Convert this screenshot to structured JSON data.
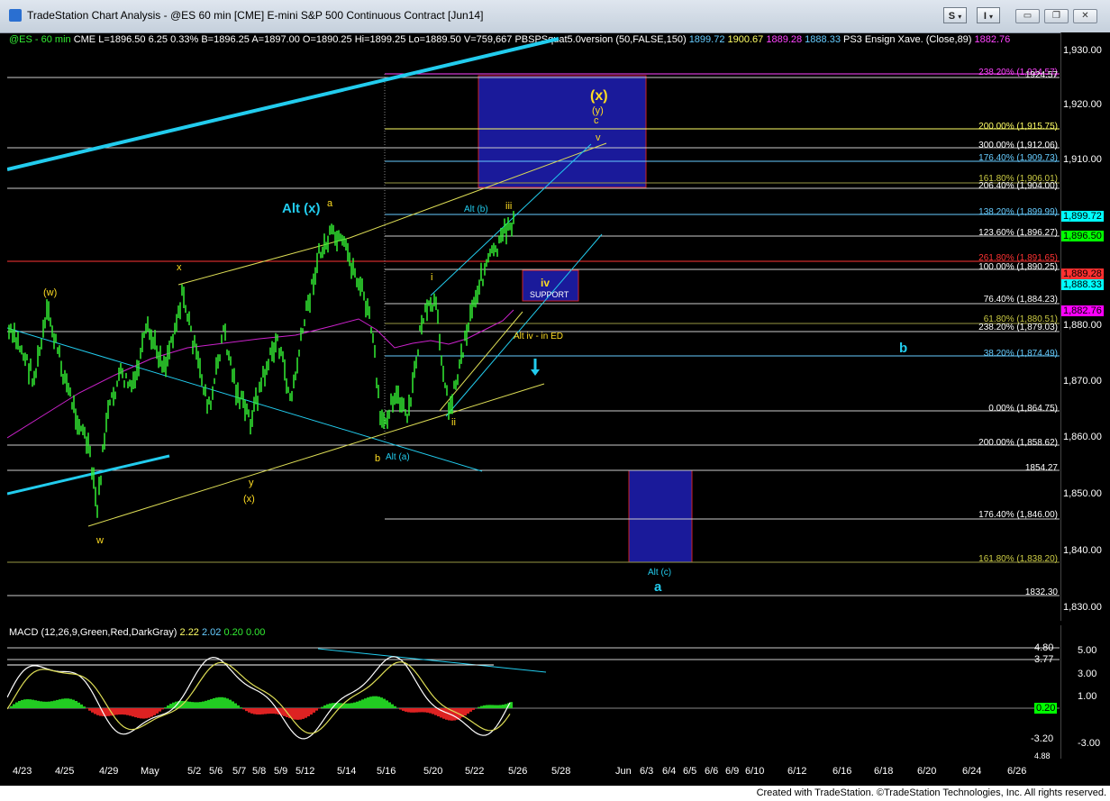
{
  "window": {
    "title": "TradeStation Chart Analysis - @ES 60 min [CME] E-mini S&P 500 Continuous Contract [Jun14]",
    "btn_s": "S",
    "btn_i": "I",
    "dropdown_arrow": "▾",
    "minimize": "▭",
    "restore": "❐",
    "close": "✕"
  },
  "info": {
    "symbol": "@ES - 60 min",
    "exchange": "CME",
    "last": "L=1896.50",
    "change": "6.25",
    "pct": "0.33%",
    "bid": "B=1896.25",
    "ask": "A=1897.00",
    "open": "O=1890.25",
    "high": "Hi=1899.25",
    "low": "Lo=1889.50",
    "volume": "V=759,667",
    "study": "PBSPSquat5.0version (50,FALSE,150)",
    "s1": "1899.72",
    "s2": "1900.67",
    "s3": "1889.28",
    "s4": "1888.33",
    "study2": "PS3 Ensign Xave. (Close,89)",
    "s5": "1882.76"
  },
  "macd": {
    "label": "MACD (12,26,9,Green,Red,DarkGray)",
    "v1": "2.22",
    "v2": "2.02",
    "v3": "0.20",
    "v4": "0.00",
    "axis": [
      "5.00",
      "3.00",
      "1.00",
      "-3.20",
      "-3.00"
    ],
    "tags": [
      "4.80",
      "3.77",
      "0.20",
      "4.88"
    ]
  },
  "price_axis": [
    "1,930.00",
    "1,920.00",
    "1,910.00",
    "1,880.00",
    "1,870.00",
    "1,860.00",
    "1,850.00",
    "1,840.00",
    "1,830.00"
  ],
  "price_tags": [
    {
      "t": "1,899.72",
      "bg": "#00ffff"
    },
    {
      "t": "1,896.50",
      "bg": "#00ff00"
    },
    {
      "t": "1,889.28",
      "bg": "#ff3030"
    },
    {
      "t": "1,888.33",
      "bg": "#00ffff"
    },
    {
      "t": "1,882.76",
      "bg": "#ff00ff"
    }
  ],
  "fib_levels": [
    {
      "text": "238.20% (1,924.57)",
      "color": "#ff44ff"
    },
    {
      "text": "1924.57",
      "color": "#ffffff"
    },
    {
      "text": "200.00% (1,915.75)",
      "color": "#ffff66"
    },
    {
      "text": "300.00% (1,912.06)",
      "color": "#ffffff"
    },
    {
      "text": "176.40% (1,909.73)",
      "color": "#66ccff"
    },
    {
      "text": "161.80% (1,906.01)",
      "color": "#cccc44"
    },
    {
      "text": "206.40% (1,904.00)",
      "color": "#ffffff"
    },
    {
      "text": "138.20% (1,899.99)",
      "color": "#66ccff"
    },
    {
      "text": "123.60% (1,896.27)",
      "color": "#ffffff"
    },
    {
      "text": "261.80% (1,891.65)",
      "color": "#ff3333"
    },
    {
      "text": "100.00% (1,890.25)",
      "color": "#ffffff"
    },
    {
      "text": "76.40% (1,884.23)",
      "color": "#ffffff"
    },
    {
      "text": "61.80% (1,880.51)",
      "color": "#cccc44"
    },
    {
      "text": "238.20% (1,879.03)",
      "color": "#ffffff"
    },
    {
      "text": "38.20% (1,874.49)",
      "color": "#66ccff"
    },
    {
      "text": "0.00% (1,864.75)",
      "color": "#ffffff"
    },
    {
      "text": "200.00% (1,858.62)",
      "color": "#ffffff"
    },
    {
      "text": "1854.27",
      "color": "#ffffff"
    },
    {
      "text": "176.40% (1,846.00)",
      "color": "#ffffff"
    },
    {
      "text": "161.80% (1,838.20)",
      "color": "#cccc44"
    },
    {
      "text": "1832.30",
      "color": "#ffffff"
    }
  ],
  "wave_labels": {
    "x_paren": "(x)",
    "y_paren": "(y)",
    "c": "c",
    "v": "v",
    "alt_x": "Alt (x)",
    "a_small": "a",
    "alt_b": "Alt (b)",
    "iii": "iii",
    "i": "i",
    "iv": "iv",
    "support": "SUPPORT",
    "alt_iv": "Alt iv - in ED",
    "b_blue": "b",
    "w_paren": "(w)",
    "x_small": "x",
    "ii": "ii",
    "b_small": "b",
    "alt_a": "Alt (a)",
    "y_small": "y",
    "x_paren2": "(x)",
    "w_small": "w",
    "alt_c": "Alt (c)",
    "a_blue": "a"
  },
  "dates": [
    "4/23",
    "4/25",
    "4/29",
    "May",
    "5/2",
    "5/6",
    "5/7",
    "5/8",
    "5/9",
    "5/12",
    "5/14",
    "5/16",
    "5/20",
    "5/22",
    "5/26",
    "5/28",
    "Jun",
    "6/3",
    "6/4",
    "6/5",
    "6/6",
    "6/9",
    "6/10",
    "6/12",
    "6/16",
    "6/18",
    "6/20",
    "6/24",
    "6/26"
  ],
  "footer": "Created with TradeStation. ©TradeStation Technologies, Inc. All rights reserved.",
  "colors": {
    "price_bars": "#33ee33",
    "channel": "#22ccee",
    "wedge": "#dddd55",
    "box": "#1a1a9a",
    "box_border": "#cc2222"
  }
}
